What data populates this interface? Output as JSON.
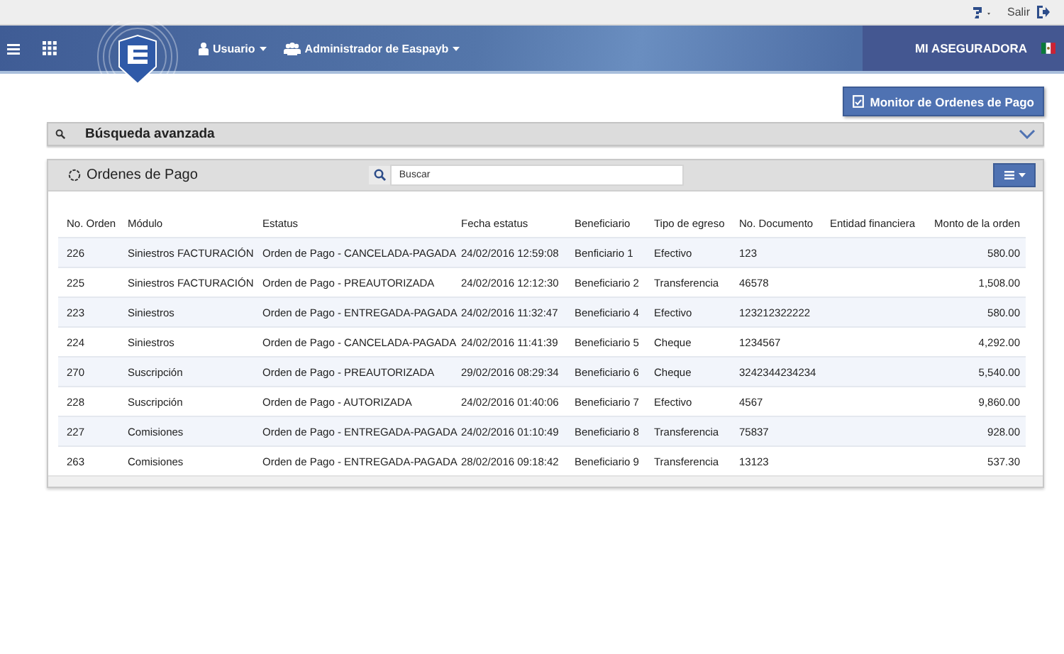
{
  "topbar": {
    "logout": "Salir"
  },
  "header": {
    "user_menu": "Usuario",
    "role_menu": "Administrador de Easpayb",
    "company": "MI ASEGURADORA"
  },
  "monitor_button": "Monitor de Ordenes de Pago",
  "advanced_search": {
    "title": "Búsqueda avanzada"
  },
  "panel": {
    "title": "Ordenes de Pago",
    "search": {
      "placeholder": "Buscar"
    },
    "table": {
      "columns": [
        "No. Orden",
        "Módulo",
        "Estatus",
        "Fecha estatus",
        "Beneficiario",
        "Tipo de egreso",
        "No. Documento",
        "Entidad financiera",
        "Monto de la orden"
      ],
      "rows": [
        [
          "226",
          "Siniestros FACTURACIÓN",
          "Orden de Pago - CANCELADA-PAGADA",
          "24/02/2016 12:59:08",
          "Benficiario 1",
          "Efectivo",
          "123",
          "",
          "580.00"
        ],
        [
          "225",
          "Siniestros FACTURACIÓN",
          "Orden de Pago - PREAUTORIZADA",
          "24/02/2016 12:12:30",
          "Beneficiario 2",
          "Transferencia",
          "46578",
          "",
          "1,508.00"
        ],
        [
          "223",
          "Siniestros",
          "Orden de Pago - ENTREGADA-PAGADA",
          "24/02/2016 11:32:47",
          "Beneficiario 4",
          "Efectivo",
          "123212322222",
          "",
          "580.00"
        ],
        [
          "224",
          "Siniestros",
          "Orden de Pago - CANCELADA-PAGADA",
          "24/02/2016 11:41:39",
          "Beneficiario 5",
          "Cheque",
          "1234567",
          "",
          "4,292.00"
        ],
        [
          "270",
          "Suscripción",
          "Orden de Pago - PREAUTORIZADA",
          "29/02/2016 08:29:34",
          "Beneficiario 6",
          "Cheque",
          "3242344234234",
          "",
          "5,540.00"
        ],
        [
          "228",
          "Suscripción",
          "Orden de Pago - AUTORIZADA",
          "24/02/2016 01:40:06",
          "Beneficiario 7",
          "Efectivo",
          "4567",
          "",
          "9,860.00"
        ],
        [
          "227",
          "Comisiones",
          "Orden de Pago - ENTREGADA-PAGADA",
          "24/02/2016 01:10:49",
          "Beneficiario 8",
          "Transferencia",
          "75837",
          "",
          "928.00"
        ],
        [
          "263",
          "Comisiones",
          "Orden de Pago - ENTREGADA-PAGADA",
          "28/02/2016 09:18:42",
          "Beneficiario 9",
          "Transferencia",
          "13123",
          "",
          "537.30"
        ]
      ]
    }
  }
}
